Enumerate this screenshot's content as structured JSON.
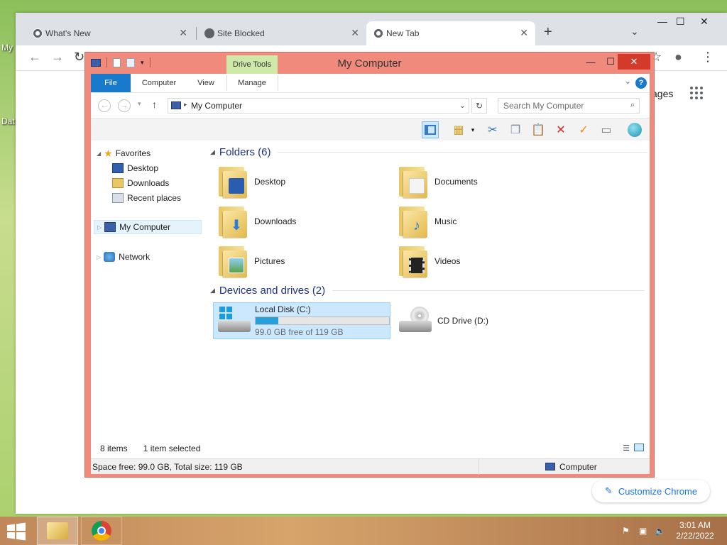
{
  "desktop": {
    "icon_labels": [
      "My",
      "Dat"
    ]
  },
  "chrome": {
    "tabs": [
      {
        "label": "What's New",
        "active": false
      },
      {
        "label": "Site Blocked",
        "active": false
      },
      {
        "label": "New Tab",
        "active": true
      }
    ],
    "new_tab_symbol": "+",
    "images_link": "ages",
    "customize_label": "Customize Chrome"
  },
  "explorer": {
    "title": "My Computer",
    "context_tab": "Drive Tools",
    "ribbon_tabs": [
      "File",
      "Computer",
      "View",
      "Manage"
    ],
    "address": "My Computer",
    "search_placeholder": "Search My Computer",
    "nav": {
      "favorites": "Favorites",
      "favorites_items": [
        "Desktop",
        "Downloads",
        "Recent places"
      ],
      "computer": "My Computer",
      "network": "Network"
    },
    "folders_header": "Folders (6)",
    "folders": [
      "Desktop",
      "Documents",
      "Downloads",
      "Music",
      "Pictures",
      "Videos"
    ],
    "devices_header": "Devices and drives (2)",
    "drives": [
      {
        "name": "Local Disk (C:)",
        "free_text": "99.0 GB free of 119 GB",
        "used_fraction": 0.168
      },
      {
        "name": "CD Drive (D:)"
      }
    ],
    "status_items": "8 items",
    "status_selected": "1 item selected",
    "detail_space": "Space free: 99.0 GB, Total size: 119 GB",
    "detail_location": "Computer"
  },
  "taskbar": {
    "time": "3:01 AM",
    "date": "2/22/2022"
  },
  "colors": {
    "explorer_frame": "#f08a7c",
    "file_tab": "#1979ca",
    "drive_tools": "#cfe9a9",
    "selection": "#cce8ff",
    "drive_bar": "#26a0da",
    "group_header": "#1e3287"
  }
}
